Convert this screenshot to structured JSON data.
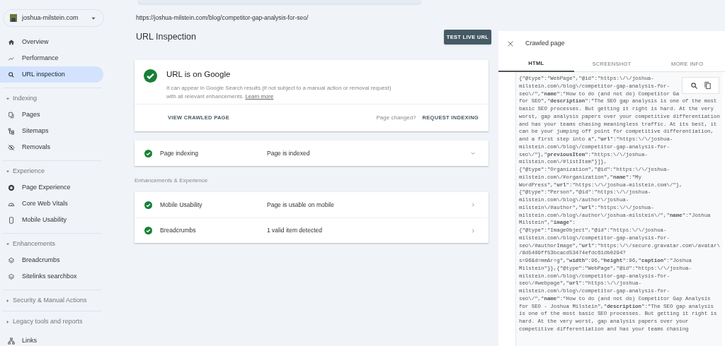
{
  "sidebar": {
    "property": {
      "name": "joshua-milstein.com"
    },
    "items": [
      {
        "kind": "link",
        "label": "Overview",
        "selected": false
      },
      {
        "kind": "link",
        "label": "Performance",
        "selected": false
      },
      {
        "kind": "link",
        "label": "URL inspection",
        "selected": true
      },
      {
        "kind": "section",
        "label": "Indexing",
        "expanded": true,
        "children": [
          {
            "kind": "link",
            "label": "Pages",
            "selected": false
          },
          {
            "kind": "link",
            "label": "Sitemaps",
            "selected": false
          },
          {
            "kind": "link",
            "label": "Removals",
            "selected": false
          }
        ]
      },
      {
        "kind": "section",
        "label": "Experience",
        "expanded": true,
        "children": [
          {
            "kind": "link",
            "label": "Page Experience",
            "selected": false
          },
          {
            "kind": "link",
            "label": "Core Web Vitals",
            "selected": false
          },
          {
            "kind": "link",
            "label": "Mobile Usability",
            "selected": false
          }
        ]
      },
      {
        "kind": "section",
        "label": "Enhancements",
        "expanded": true,
        "children": [
          {
            "kind": "link",
            "label": "Breadcrumbs",
            "selected": false
          },
          {
            "kind": "link",
            "label": "Sitelinks searchbox",
            "selected": false
          }
        ]
      },
      {
        "kind": "section",
        "label": "Security & Manual Actions",
        "expanded": false
      },
      {
        "kind": "section",
        "label": "Legacy tools and reports",
        "expanded": false
      },
      {
        "kind": "link",
        "label": "Links",
        "selected": false
      }
    ]
  },
  "url": "https://joshua-milstein.com/blog/competitor-gap-analysis-for-seo/",
  "page_title": "URL Inspection",
  "test_button": "TEST LIVE URL",
  "status_card": {
    "title": "URL is on Google",
    "description": "It can appear in Google Search results (if not subject to a manual action or removal request) with all relevant enhancements.",
    "link": "Learn more",
    "view_button": "VIEW CRAWLED PAGE",
    "changed_label": "Page changed?",
    "request_button": "REQUEST INDEXING"
  },
  "indexing_rows": [
    {
      "kind": "expand",
      "label": "Page indexing",
      "status": "Page is indexed",
      "expanded": false
    }
  ],
  "enhancements_heading": "Enhancements & Experience",
  "enhancement_rows": [
    {
      "kind": "link",
      "label": "Mobile Usability",
      "status": "Page is usable on mobile"
    },
    {
      "kind": "link",
      "label": "Breadcrumbs",
      "status": "1 valid item detected"
    }
  ],
  "drawer": {
    "title": "Crawled page",
    "tabs": [
      {
        "label": "HTML",
        "selected": true
      },
      {
        "label": "SCREENSHOT",
        "selected": false
      },
      {
        "label": "MORE INFO",
        "selected": false
      }
    ],
    "code_lines": [
      "{\"@type\":\"WebPage\",\"@id\":\"https:\\/\\/joshua-",
      "milstein.com\\/blog\\/competitor-gap-analysis-for-",
      "seo\\/\",\"**name**\":\"How to do (and not do) Competitor Ga",
      "for SEO\",\"**description**\":\"The SEO gap analysis is one of the most",
      "basic SEO processes. But getting it right is hard. At the very",
      "worst, gap analysis papers over your competitive differentiation",
      "and has your teams chasing meaningless traffic. At its best, it",
      "can be your jumping off point for competitive differentiation,",
      "and a first step into a\",\"**url**\":\"https:\\/\\/joshua-",
      "milstein.com\\/blog\\/competitor-gap-analysis-for-",
      "seo\\/\"},\"**previousItem**\":\"https:\\/\\/joshua-",
      "milstein.com\\/#listItem\"}]},",
      "{\"@type\":\"Organization\",\"@id\":\"https:\\/\\/joshua-",
      "milstein.com\\/#organization\",\"**name**\":\"My",
      "WordPress\",\"**url**\":\"https:\\/\\/joshua-milstein.com\\/\"},",
      "{\"@type\":\"Person\",\"@id\":\"https:\\/\\/joshua-",
      "milstein.com\\/blog\\/author\\/joshua-",
      "milstein\\/#author\",\"**url**\":\"https:\\/\\/joshua-",
      "milstein.com\\/blog\\/author\\/joshua-milstein\\/\",\"**name**\":\"Joshua",
      "Milstein\",\"**image**\":",
      "{\"@type\":\"ImageObject\",\"@id\":\"https:\\/\\/joshua-",
      "milstein.com\\/blog\\/competitor-gap-analysis-for-",
      "seo\\/#authorImage\",\"**url**\":\"https:\\/\\/secure.gravatar.com\\/avatar\\",
      "/8d5409ff53bcacd53474efdc61db0294?",
      "s=96&d=mm&r=g\",\"**width**\":96,\"**height**\":96,\"**caption**\":\"Joshua",
      "Milstein\"}},{\"@type\":\"WebPage\",\"@id\":\"https:\\/\\/joshua-",
      "milstein.com\\/blog\\/competitor-gap-analysis-for-",
      "seo\\/#webpage\",\"**url**\":\"https:\\/\\/joshua-",
      "milstein.com\\/blog\\/competitor-gap-analysis-for-",
      "seo\\/\",\"**name**\":\"How to do (and not do) Competitor Gap Analysis",
      "for SEO - Joshua Milstein\",\"**description**\":\"The SEO gap analysis",
      "is one of the most basic SEO processes. But getting it right is",
      "hard. At the very worst, gap analysis papers over your",
      "competitive differentiation and has your teams chasing"
    ]
  }
}
